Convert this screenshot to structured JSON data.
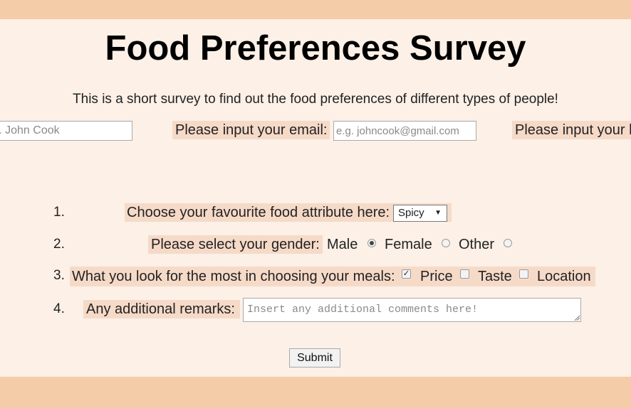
{
  "header": {
    "title": "Food Preferences Survey",
    "subtitle": "This is a short survey to find out the food preferences of different types of people!"
  },
  "fields": {
    "name_placeholder": "e.g. John Cook",
    "email_label": "Please input your email:",
    "email_placeholder": "e.g. johncook@gmail.com",
    "third_label": "Please input your h"
  },
  "questions": [
    {
      "number": "1.",
      "label": "Choose your favourite food attribute here:",
      "selected": "Spicy",
      "caret": "▼"
    },
    {
      "number": "2.",
      "label": "Please select your gender:",
      "options": [
        {
          "label": "Male",
          "checked": true
        },
        {
          "label": "Female",
          "checked": false
        },
        {
          "label": "Other",
          "checked": false
        }
      ]
    },
    {
      "number": "3.",
      "label": "What you look for the most in choosing your meals:",
      "options": [
        {
          "label": "Price",
          "checked": true,
          "mark": "✓"
        },
        {
          "label": "Taste",
          "checked": false
        },
        {
          "label": "Location",
          "checked": false
        }
      ]
    },
    {
      "number": "4.",
      "label": "Any additional remarks:",
      "placeholder": "Insert any additional comments here!"
    }
  ],
  "submit_label": "Submit",
  "colors": {
    "outer_background": "#f5cca8",
    "panel_background": "#fcf0e7",
    "label_highlight": "#f6dac8"
  }
}
